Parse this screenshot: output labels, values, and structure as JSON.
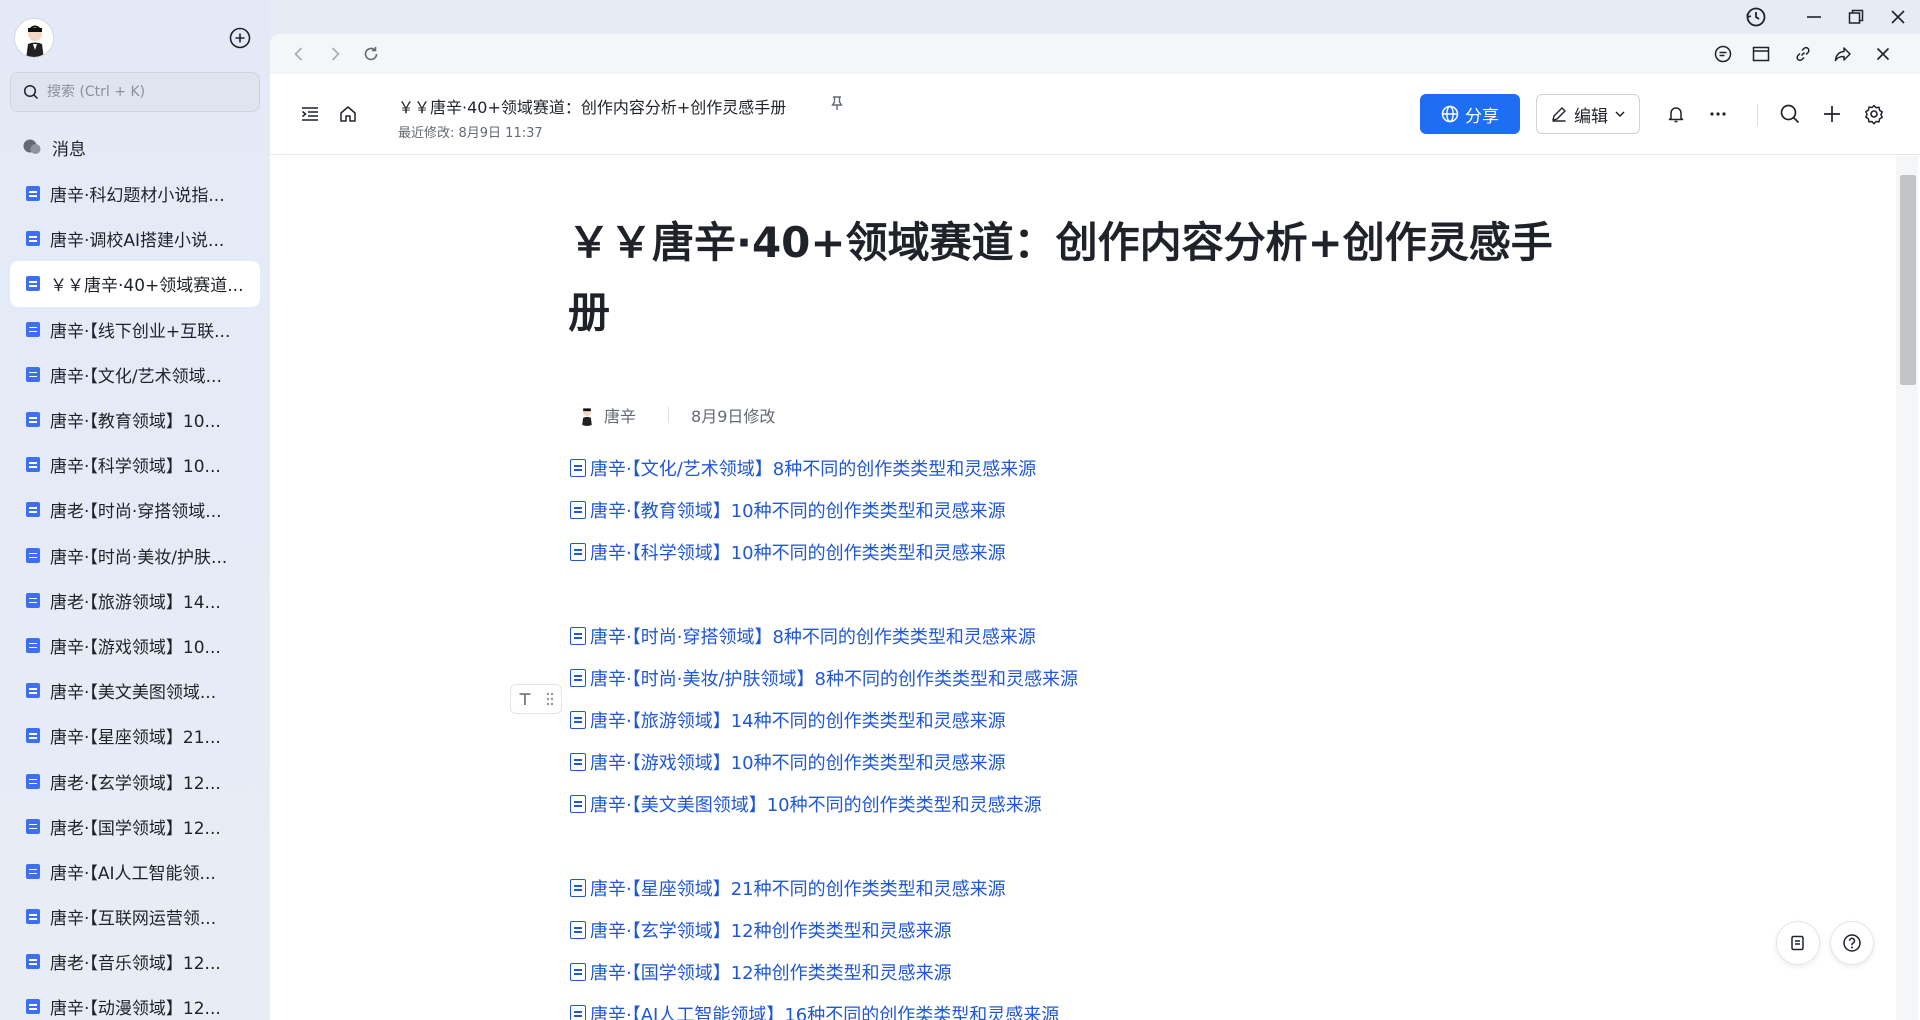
{
  "sidebar": {
    "search_placeholder": "搜索 (Ctrl + K)",
    "messages_label": "消息",
    "items": [
      {
        "label": "唐辛·科幻题材小说指...",
        "active": false
      },
      {
        "label": "唐辛·调校AI搭建小说...",
        "active": false
      },
      {
        "label": "￥￥唐辛·40+领域赛道...",
        "active": true
      },
      {
        "label": "唐辛·【线下创业+互联...",
        "active": false
      },
      {
        "label": "唐辛·【文化/艺术领域...",
        "active": false
      },
      {
        "label": "唐辛·【教育领域】10...",
        "active": false
      },
      {
        "label": "唐辛·【科学领域】10...",
        "active": false
      },
      {
        "label": "唐老·【时尚·穿搭领域...",
        "active": false
      },
      {
        "label": "唐辛·【时尚·美妆/护肤...",
        "active": false
      },
      {
        "label": "唐老·【旅游领域】14...",
        "active": false
      },
      {
        "label": "唐辛·【游戏领域】10...",
        "active": false
      },
      {
        "label": "唐辛·【美文美图领域...",
        "active": false
      },
      {
        "label": "唐辛·【星座领域】21...",
        "active": false
      },
      {
        "label": "唐老·【玄学领域】12...",
        "active": false
      },
      {
        "label": "唐老·【国学领域】12...",
        "active": false
      },
      {
        "label": "唐辛·【AI人工智能领...",
        "active": false
      },
      {
        "label": "唐辛·【互联网运营领...",
        "active": false
      },
      {
        "label": "唐老·【音乐领域】12...",
        "active": false
      },
      {
        "label": "唐辛·【动漫领域】12...",
        "active": false
      }
    ]
  },
  "header": {
    "doc_title": "￥￥唐辛·40+领域赛道：创作内容分析+创作灵感手册",
    "last_modified": "最近修改: 8月9日 11:37",
    "share_label": "分享",
    "edit_label": "编辑"
  },
  "document": {
    "title": "￥￥唐辛·40+领域赛道：创作内容分析+创作灵感手册",
    "author": "唐辛",
    "modified": "8月9日修改",
    "links": [
      "唐辛·【文化/艺术领域】8种不同的创作类类型和灵感来源",
      "唐辛·【教育领域】10种不同的创作类类型和灵感来源",
      "唐辛·【科学领域】10种不同的创作类类型和灵感来源",
      "唐辛·【时尚·穿搭领域】8种不同的创作类类型和灵感来源",
      "唐辛·【时尚·美妆/护肤领域】8种不同的创作类类型和灵感来源",
      "唐辛·【旅游领域】14种不同的创作类类型和灵感来源",
      "唐辛·【游戏领域】10种不同的创作类类型和灵感来源",
      "唐辛·【美文美图领域】10种不同的创作类类型和灵感来源",
      "唐辛·【星座领域】21种不同的创作类类型和灵感来源",
      "唐辛·【玄学领域】12种创作类类型和灵感来源",
      "唐辛·【国学领域】12种创作类类型和灵感来源",
      "唐辛·【AI人工智能领域】16种不同的创作类类型和灵感来源"
    ]
  },
  "colors": {
    "accent": "#1e6ef4",
    "link": "#2057d6",
    "doc_icon": "#3d6ff5",
    "sidebar_bg": "#e3e9f6"
  }
}
